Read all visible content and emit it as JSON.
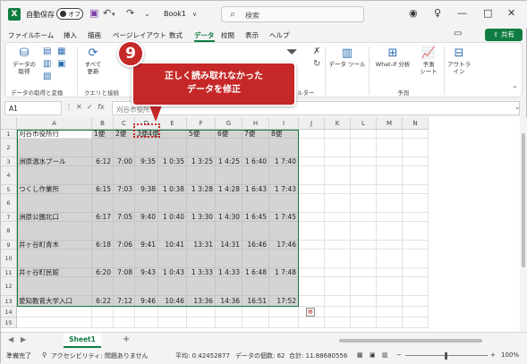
{
  "titlebar": {
    "autosave_label": "自動保存",
    "autosave_state": "オフ",
    "filename": "Book1",
    "filename_caret": "∨",
    "search_placeholder": "検索"
  },
  "menu": {
    "items": [
      "ファイル",
      "ホーム",
      "挿入",
      "描画",
      "ページレイアウト",
      "数式",
      "データ",
      "校閲",
      "表示",
      "ヘルプ"
    ],
    "active": "データ",
    "share_label": "共有"
  },
  "ribbon": {
    "get_data_label": "データの\n取得",
    "refresh_label": "すべて\n更新",
    "data_tools_label": "データ ツール",
    "whatif_label": "What-If 分析",
    "forecast_sheet_label": "予測\nシート",
    "outline_label": "アウトライン",
    "group_get_transform": "データの取得と変換",
    "group_queries": "クエリと接続",
    "group_forecast": "予測",
    "group_partial": "ルター"
  },
  "formula_bar": {
    "name_box": "A1",
    "content": "刈谷市役所"
  },
  "grid": {
    "columns": [
      "A",
      "B",
      "C",
      "D",
      "E",
      "F",
      "G",
      "H",
      "I",
      "J",
      "K",
      "L",
      "M",
      "N"
    ],
    "rows": [
      "1",
      "2",
      "3",
      "4",
      "5",
      "6",
      "7",
      "8",
      "9",
      "10",
      "11",
      "12",
      "13",
      "14",
      "15"
    ],
    "header_row": {
      "a": "刈谷市役所行",
      "b": "1便",
      "c": "2便",
      "d": "3便4便",
      "f": "5便",
      "g": "6便",
      "h": "7便",
      "i": "8便"
    },
    "data_rows": [
      {
        "row": "3",
        "name": "洲原温水プール",
        "values": [
          "6:12",
          "7:00",
          "9:35",
          "1 0:35",
          "1 3:25",
          "1 4:25",
          "1 6:40",
          "1 7:40"
        ]
      },
      {
        "row": "5",
        "name": "つくし作業所",
        "values": [
          "6:15",
          "7:03",
          "9:38",
          "1 0:38",
          "1 3:28",
          "1 4:28",
          "1 6:43",
          "1 7:43"
        ]
      },
      {
        "row": "7",
        "name": "洲原公園北口",
        "values": [
          "6:17",
          "7:05",
          "9:40",
          "1 0:40",
          "1 3:30",
          "1 4:30",
          "1 6:45",
          "1 7:45"
        ]
      },
      {
        "row": "9",
        "name": "井ヶ谷町青木",
        "values": [
          "6:18",
          "7:06",
          "9:41",
          "10:41",
          "13:31",
          "14:31",
          "16:46",
          "17:46"
        ]
      },
      {
        "row": "11",
        "name": "井ヶ谷町民館",
        "values": [
          "6:20",
          "7:08",
          "9:43",
          "1 0:43",
          "1 3:33",
          "1 4:33",
          "1 6:48",
          "1 7:48"
        ]
      },
      {
        "row": "13",
        "name": "愛知教育大学入口",
        "values": [
          "6:22",
          "7:12",
          "9:46",
          "10:46",
          "13:36",
          "14:36",
          "16:51",
          "17:52"
        ]
      }
    ]
  },
  "callout": {
    "badge": "9",
    "line1": "正しく読み取れなかった",
    "line2": "データを修正"
  },
  "sheets": {
    "tabs": [
      "Sheet1"
    ],
    "add": "+"
  },
  "status": {
    "ready": "準備完了",
    "accessibility": "アクセシビリティ: 問題ありません",
    "average": "平均: 0.42452877",
    "count": "データの個数: 62",
    "sum": "合計: 11.88680556",
    "zoom": "100%"
  }
}
